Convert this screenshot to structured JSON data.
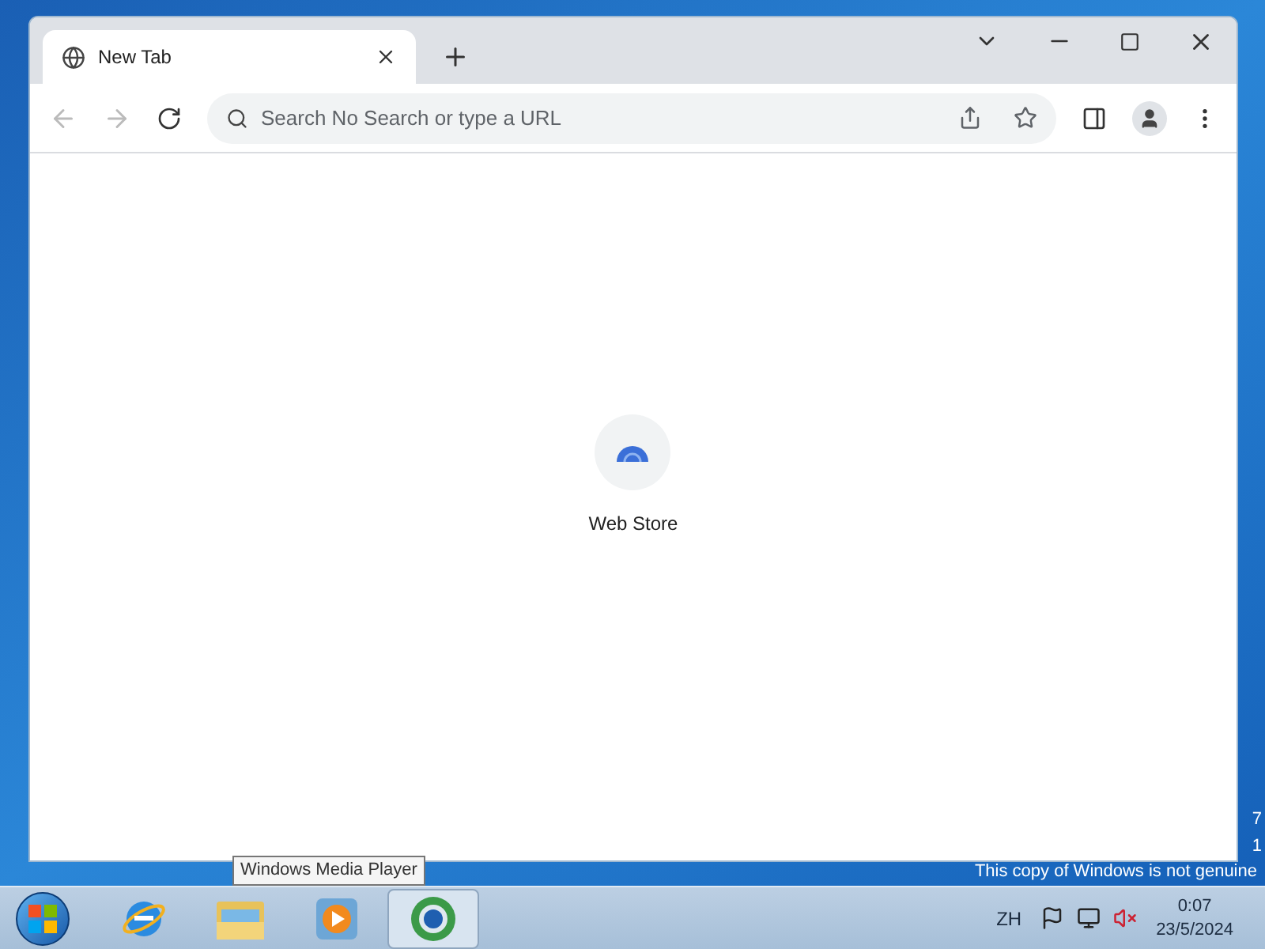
{
  "browser": {
    "tabs": [
      {
        "title": "New Tab",
        "selected": true
      }
    ],
    "address_bar": {
      "placeholder": "Search No Search or type a URL"
    },
    "shortcuts": [
      {
        "label": "Web Store"
      }
    ]
  },
  "desktop": {
    "edge_texts": [
      "7",
      "1"
    ],
    "notice": "This copy of Windows is not genuine"
  },
  "tooltip": "Windows Media Player",
  "taskbar": {
    "apps": [
      {
        "kind": "ie",
        "selected": false
      },
      {
        "kind": "explorer",
        "selected": false
      },
      {
        "kind": "media",
        "selected": false
      },
      {
        "kind": "chrome",
        "selected": true
      }
    ],
    "language": "ZH",
    "time": "0:07",
    "date": "23/5/2024"
  }
}
